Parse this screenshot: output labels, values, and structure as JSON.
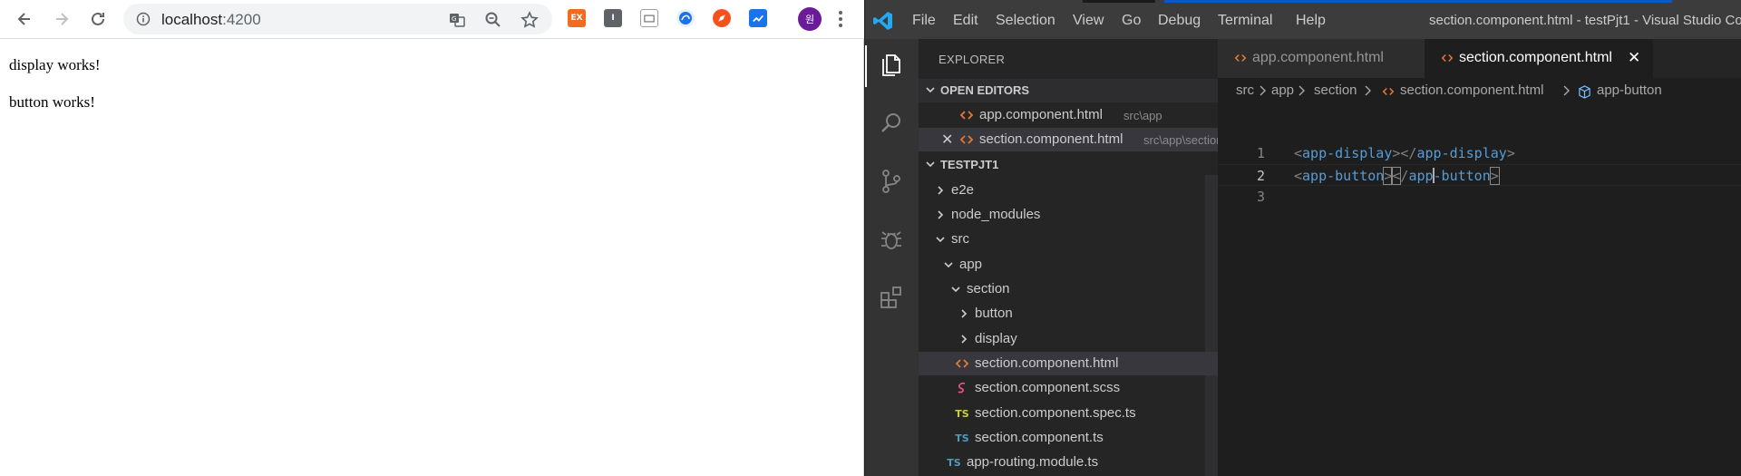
{
  "browser": {
    "url_host": "localhost",
    "url_port": ":4200",
    "avatar_text": "원",
    "extensions": [
      {
        "name": "ex-extension-icon",
        "label": "EX",
        "color": "#f26b21"
      },
      {
        "name": "bookmark-extension-icon",
        "label": "I",
        "color": "#5f6368"
      },
      {
        "name": "screen-extension-icon",
        "label": "",
        "color": "#9e9e9e"
      },
      {
        "name": "edge-extension-icon",
        "label": "",
        "color": "#1a73e8"
      },
      {
        "name": "rocket-extension-icon",
        "label": "",
        "color": "#f4511e"
      },
      {
        "name": "chart-extension-icon",
        "label": "",
        "color": "#1a73e8"
      }
    ],
    "page_lines": [
      "display works!",
      "button works!"
    ]
  },
  "vscode": {
    "menu": [
      "File",
      "Edit",
      "Selection",
      "View",
      "Go",
      "Debug",
      "Terminal",
      "Help"
    ],
    "window_title": "section.component.html - testPjt1 - Visual Studio Co",
    "explorer_title": "EXPLORER",
    "open_editors_header": "OPEN EDITORS",
    "open_editors": [
      {
        "name": "app.component.html",
        "path": "src\\app"
      },
      {
        "name": "section.component.html",
        "path": "src\\app\\section"
      }
    ],
    "project_header": "TESTPJT1",
    "tree": [
      {
        "label": "e2e"
      },
      {
        "label": "node_modules"
      },
      {
        "label": "src"
      },
      {
        "label": "app"
      },
      {
        "label": "section"
      },
      {
        "label": "button"
      },
      {
        "label": "display"
      },
      {
        "label": "section.component.html"
      },
      {
        "label": "section.component.scss"
      },
      {
        "label": "section.component.spec.ts"
      },
      {
        "label": "section.component.ts"
      },
      {
        "label": "app-routing.module.ts"
      }
    ],
    "ts_badge": "TS",
    "tabs": [
      {
        "label": "app.component.html"
      },
      {
        "label": "section.component.html"
      }
    ],
    "breadcrumb": [
      "src",
      "app",
      "section",
      "section.component.html",
      "app-button"
    ],
    "lines": [
      {
        "num": "1",
        "open_tag": "app-display",
        "close_tag": "app-display"
      },
      {
        "num": "2",
        "open_tag": "app-button",
        "close_part1": "app",
        "close_part2": "-button"
      },
      {
        "num": "3"
      }
    ],
    "colors": {
      "accent": "#007acc",
      "html_icon": "#e37933",
      "ts_yellow": "#cbcb41",
      "ts_blue": "#519aba",
      "scss_pink": "#f55385"
    }
  }
}
